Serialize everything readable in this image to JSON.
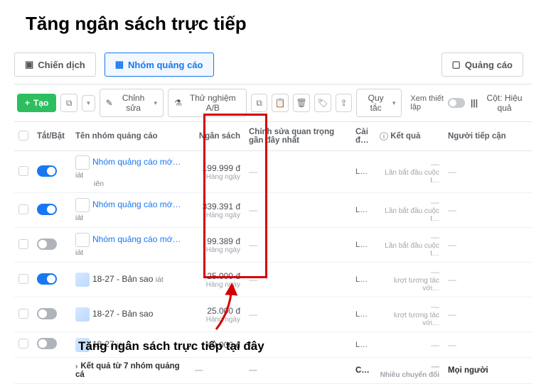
{
  "heading": "Tăng ngân sách trực tiếp",
  "tabs": {
    "campaign": "Chiến dịch",
    "adset": "Nhóm quảng cáo",
    "ad": "Quảng cáo"
  },
  "toolbar": {
    "create": "Tạo",
    "edit": "Chỉnh sửa",
    "ab": "Thử nghiệm A/B",
    "rules": "Quy tắc",
    "setup": "Xem thiết lập",
    "cols": "Cột: Hiệu quả"
  },
  "headers": {
    "onoff": "Tắt/Bật",
    "name": "Tên nhóm quảng cáo",
    "budget": "Ngân sách",
    "edits": "Chỉnh sửa quan trọng gần đây nhất",
    "setup2": "Cài đ…",
    "results": "Kết quả",
    "reach": "Người tiếp cận"
  },
  "rows": [
    {
      "on": true,
      "thumb": "empty",
      "name": "Nhóm quảng cáo mớ…",
      "link": true,
      "sub": "iát",
      "sub2": "iên",
      "budget": "199.999 đ",
      "per": "Hàng ngày",
      "setup": "L…",
      "result": "Lần bắt đầu cuộc t…"
    },
    {
      "on": true,
      "thumb": "empty",
      "name": "Nhóm quảng cáo mớ…",
      "link": true,
      "sub": "iát",
      "budget": "339.391 đ",
      "per": "Hàng ngày",
      "setup": "L…",
      "result": "Lần bắt đầu cuộc t…"
    },
    {
      "on": false,
      "thumb": "empty",
      "name": "Nhóm quảng cáo mớ…",
      "link": true,
      "sub": "iát",
      "budget": "99.389 đ",
      "per": "Hàng ngày",
      "setup": "L…",
      "result": "Lần bắt đầu cuộc t…"
    },
    {
      "on": true,
      "thumb": "img",
      "name": "18-27 - Bản sao",
      "link": false,
      "sub": "iát",
      "budget": "25.000 đ",
      "per": "Hàng ngày",
      "setup": "L…",
      "result": "lượt tương tác với…"
    },
    {
      "on": false,
      "thumb": "img",
      "name": "18-27 - Bản sao",
      "link": false,
      "sub": "",
      "budget": "25.000 đ",
      "per": "Hàng ngày",
      "setup": "L…",
      "result": "lượt tương tác với…"
    },
    {
      "on": false,
      "thumb": "img",
      "name": "18-27",
      "link": false,
      "sub": "iát",
      "budget": "40.000 đ",
      "per": "",
      "setup": "L…",
      "result": ""
    }
  ],
  "summary": {
    "label": "Kết quả từ 7 nhóm quảng cá",
    "setup": "C…",
    "result": "Nhiều chuyển đổi",
    "reach": "Mọi người"
  },
  "annotation": "Tăng ngân sách trực tiếp tại đây"
}
